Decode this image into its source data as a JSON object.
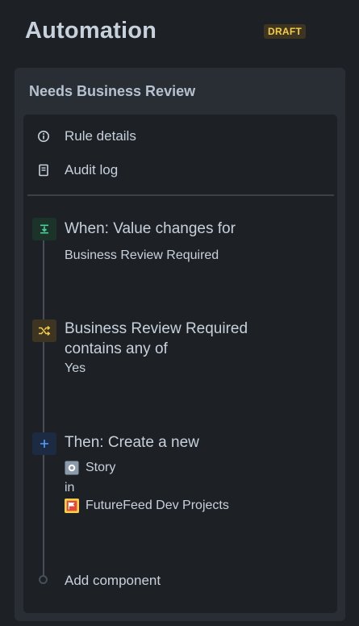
{
  "header": {
    "title": "Automation",
    "status_badge": "DRAFT"
  },
  "rule": {
    "name": "Needs Business Review",
    "menu": [
      {
        "label": "Rule details",
        "icon": "info-icon"
      },
      {
        "label": "Audit log",
        "icon": "document-icon"
      }
    ],
    "trigger": {
      "title": "When: Value changes for",
      "field": "Business Review Required",
      "icon": "trigger-icon"
    },
    "condition": {
      "title_line1": "Business Review Required",
      "title_line2": "contains any of",
      "value": "Yes",
      "icon": "shuffle-icon"
    },
    "action": {
      "title": "Then: Create a new",
      "issue_type": "Story",
      "preposition": "in",
      "project": "FutureFeed Dev Projects",
      "icon": "plus-icon"
    },
    "add_component_label": "Add component"
  },
  "colors": {
    "background": "#1d2125",
    "card": "#282e33",
    "badge_bg": "#3d3522",
    "badge_text": "#f5cd47",
    "trigger_icon_bg": "#1c3329",
    "trigger_icon_fg": "#4bce97",
    "condition_icon_bg": "#3d3522",
    "condition_icon_fg": "#f5cd47",
    "action_icon_bg": "#1c2b41",
    "action_icon_fg": "#579dff"
  }
}
